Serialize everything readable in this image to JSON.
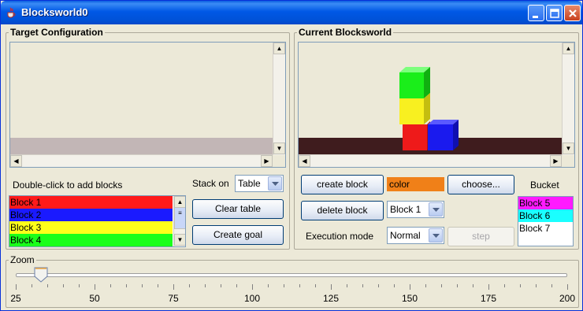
{
  "window": {
    "title": "Blocksworld0"
  },
  "target_panel": {
    "title": "Target Configuration"
  },
  "current_panel": {
    "title": "Current Blocksworld"
  },
  "controls": {
    "double_click_hint": "Double-click to add blocks",
    "stack_on_label": "Stack on",
    "stack_on_value": "Table",
    "clear_table": "Clear table",
    "create_goal": "Create goal",
    "create_block": "create block",
    "delete_block": "delete block",
    "color_label": "color",
    "color_value": "#f08018",
    "choose": "choose...",
    "block_select_value": "Block 1",
    "execution_mode_label": "Execution mode",
    "execution_mode_value": "Normal",
    "step": "step",
    "bucket_label": "Bucket"
  },
  "block_list": [
    {
      "label": "Block 1",
      "color": "#ff1a1a"
    },
    {
      "label": "Block 2",
      "color": "#1a1aff"
    },
    {
      "label": "Block 3",
      "color": "#ffff1a"
    },
    {
      "label": "Block 4",
      "color": "#1aff1a"
    }
  ],
  "bucket_list": [
    {
      "label": "Block 5",
      "color": "#ff1aff"
    },
    {
      "label": "Block 6",
      "color": "#1affff"
    },
    {
      "label": "Block 7",
      "color": "#ffffff"
    }
  ],
  "scene_blocks": [
    "green",
    "yellow",
    "red",
    "blue"
  ],
  "zoom": {
    "title": "Zoom",
    "min": 25,
    "max": 200,
    "value": 33,
    "tick_labels": [
      "25",
      "50",
      "75",
      "100",
      "125",
      "150",
      "175",
      "200"
    ]
  }
}
